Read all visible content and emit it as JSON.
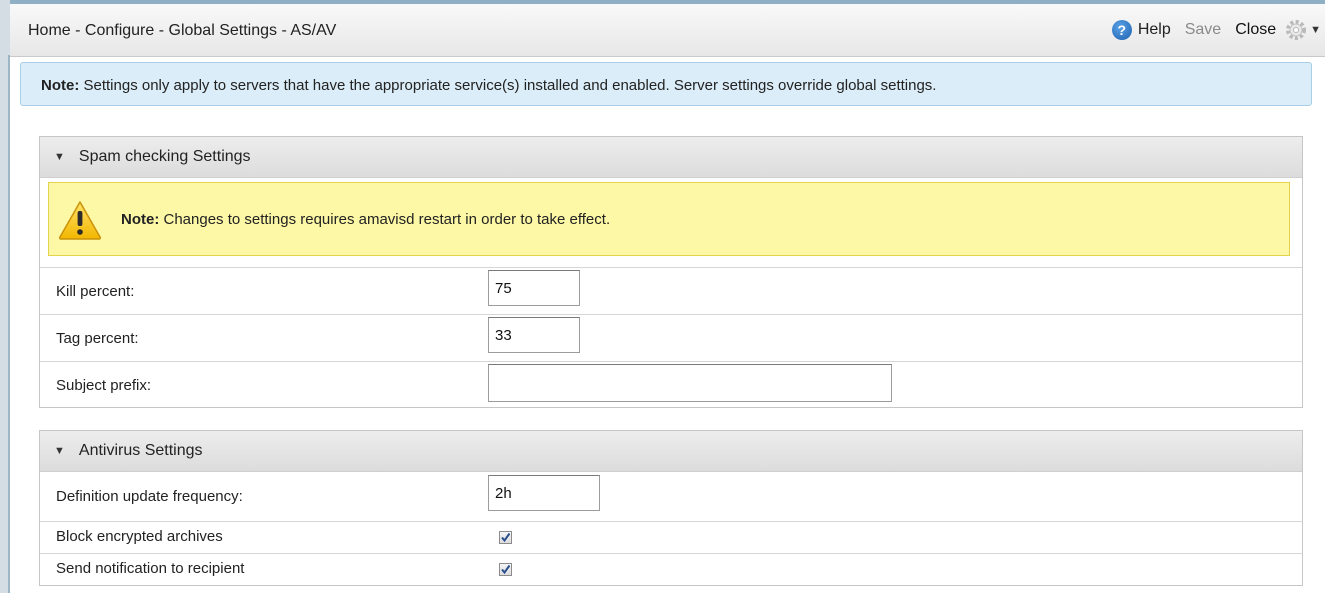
{
  "window": {
    "breadcrumb": "Home - Configure - Global Settings - AS/AV"
  },
  "toolbar": {
    "help_label": "Help",
    "save_label": "Save",
    "close_label": "Close",
    "help_icon": "help-icon",
    "gear_icon": "gear-icon",
    "save_disabled": true
  },
  "note": {
    "prefix": "Note:",
    "text": " Settings only apply to servers that have the appropriate service(s) installed and enabled. Server settings override global settings."
  },
  "spam_section": {
    "title": "Spam checking Settings",
    "expanded": true,
    "warning": {
      "prefix": "Note:",
      "text": " Changes to settings requires amavisd restart in order to take effect."
    },
    "fields": {
      "kill_percent": {
        "label": "Kill percent:",
        "value": "75"
      },
      "tag_percent": {
        "label": "Tag percent:",
        "value": "33"
      },
      "subject_prefix": {
        "label": "Subject prefix:",
        "value": ""
      }
    }
  },
  "antivirus_section": {
    "title": "Antivirus Settings",
    "expanded": true,
    "fields": {
      "definition_update_frequency": {
        "label": "Definition update frequency:",
        "value": "2h"
      },
      "block_encrypted_archives": {
        "label": "Block encrypted archives",
        "checked": true
      },
      "send_notification": {
        "label": "Send notification to recipient",
        "checked": true
      }
    }
  },
  "colors": {
    "note_bg": "#dbedf8",
    "warning_bg": "#fdf8a6",
    "header_bg": "#e3e3e3",
    "accent": "#1d5fae"
  }
}
